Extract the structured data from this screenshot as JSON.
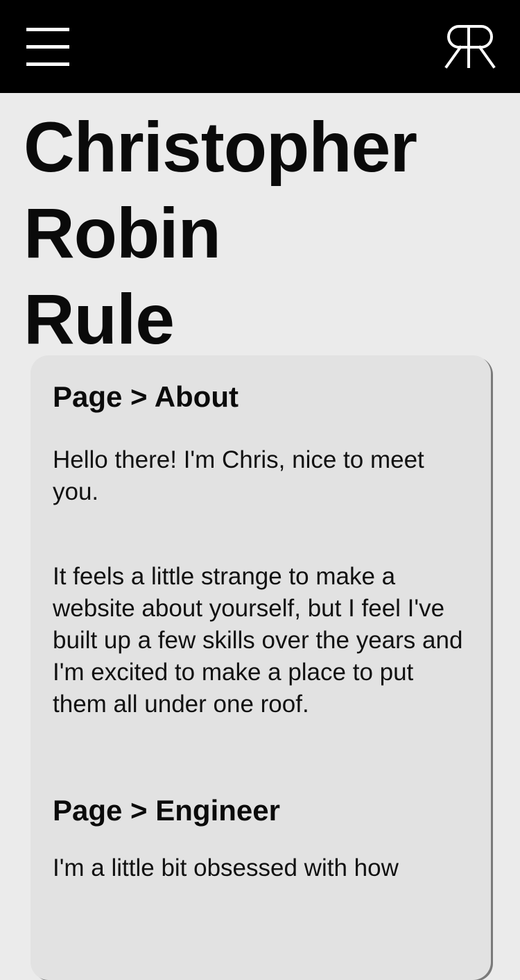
{
  "header": {
    "menu_icon": "hamburger-menu-icon",
    "logo_icon": "rr-monogram-logo"
  },
  "hero": {
    "name_line1": "Christopher",
    "name_line2": "Robin",
    "name_line3": "Rule"
  },
  "card": {
    "about_heading": "Page > About",
    "about_para1": "Hello there! I'm Chris, nice to meet you.",
    "about_para2": "It feels a little strange to make a website about yourself, but I feel I've built up a few skills over the years and I'm excited to make a place to put them all under one roof.",
    "engineer_heading": "Page > Engineer",
    "engineer_para1": "I'm a little bit obsessed with how"
  },
  "colors": {
    "header_bg": "#000000",
    "page_bg": "#ebebeb",
    "card_bg": "#e2e2e2",
    "text": "#0b0b0b"
  }
}
